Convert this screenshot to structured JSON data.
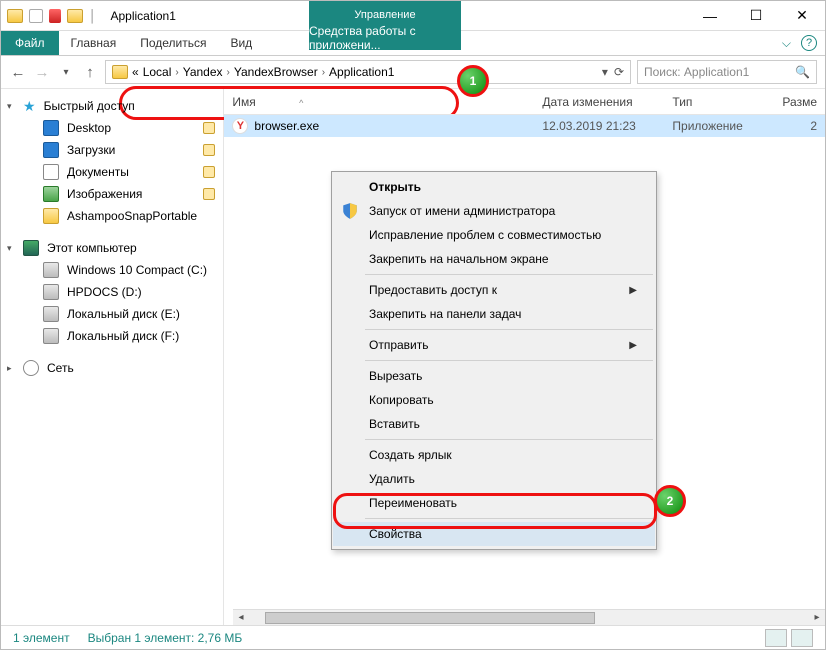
{
  "window": {
    "title": "Application1",
    "controlTab": {
      "label": "Управление",
      "sub": "Средства работы с приложени..."
    }
  },
  "ribbon": {
    "file": "Файл",
    "tabs": [
      "Главная",
      "Поделиться",
      "Вид"
    ]
  },
  "address": {
    "crumbs": [
      "Local",
      "Yandex",
      "YandexBrowser",
      "Application1"
    ],
    "searchPlaceholder": "Поиск: Application1"
  },
  "navpane": {
    "quickAccess": "Быстрый доступ",
    "quickItems": [
      "Desktop",
      "Загрузки",
      "Документы",
      "Изображения",
      "AshampooSnapPortable"
    ],
    "thisPC": "Этот компьютер",
    "drives": [
      "Windows 10 Compact (C:)",
      "HPDOCS (D:)",
      "Локальный диск (E:)",
      "Локальный диск (F:)"
    ],
    "network": "Сеть"
  },
  "columns": {
    "name": "Имя",
    "modified": "Дата изменения",
    "type": "Тип",
    "size": "Разме"
  },
  "file": {
    "name": "browser.exe",
    "modified": "12.03.2019 21:23",
    "type": "Приложение",
    "sizeFirst": "2"
  },
  "contextMenu": {
    "open": "Открыть",
    "runAsAdmin": "Запуск от имени администратора",
    "compat": "Исправление проблем с совместимостью",
    "pinStart": "Закрепить на начальном экране",
    "shareAccess": "Предоставить доступ к",
    "pinTaskbar": "Закрепить на панели задач",
    "sendTo": "Отправить",
    "cut": "Вырезать",
    "copy": "Копировать",
    "paste": "Вставить",
    "shortcut": "Создать ярлык",
    "delete": "Удалить",
    "rename": "Переименовать",
    "properties": "Свойства"
  },
  "status": {
    "count": "1 элемент",
    "selected": "Выбран 1 элемент: 2,76 МБ"
  },
  "badges": {
    "one": "1",
    "two": "2"
  }
}
